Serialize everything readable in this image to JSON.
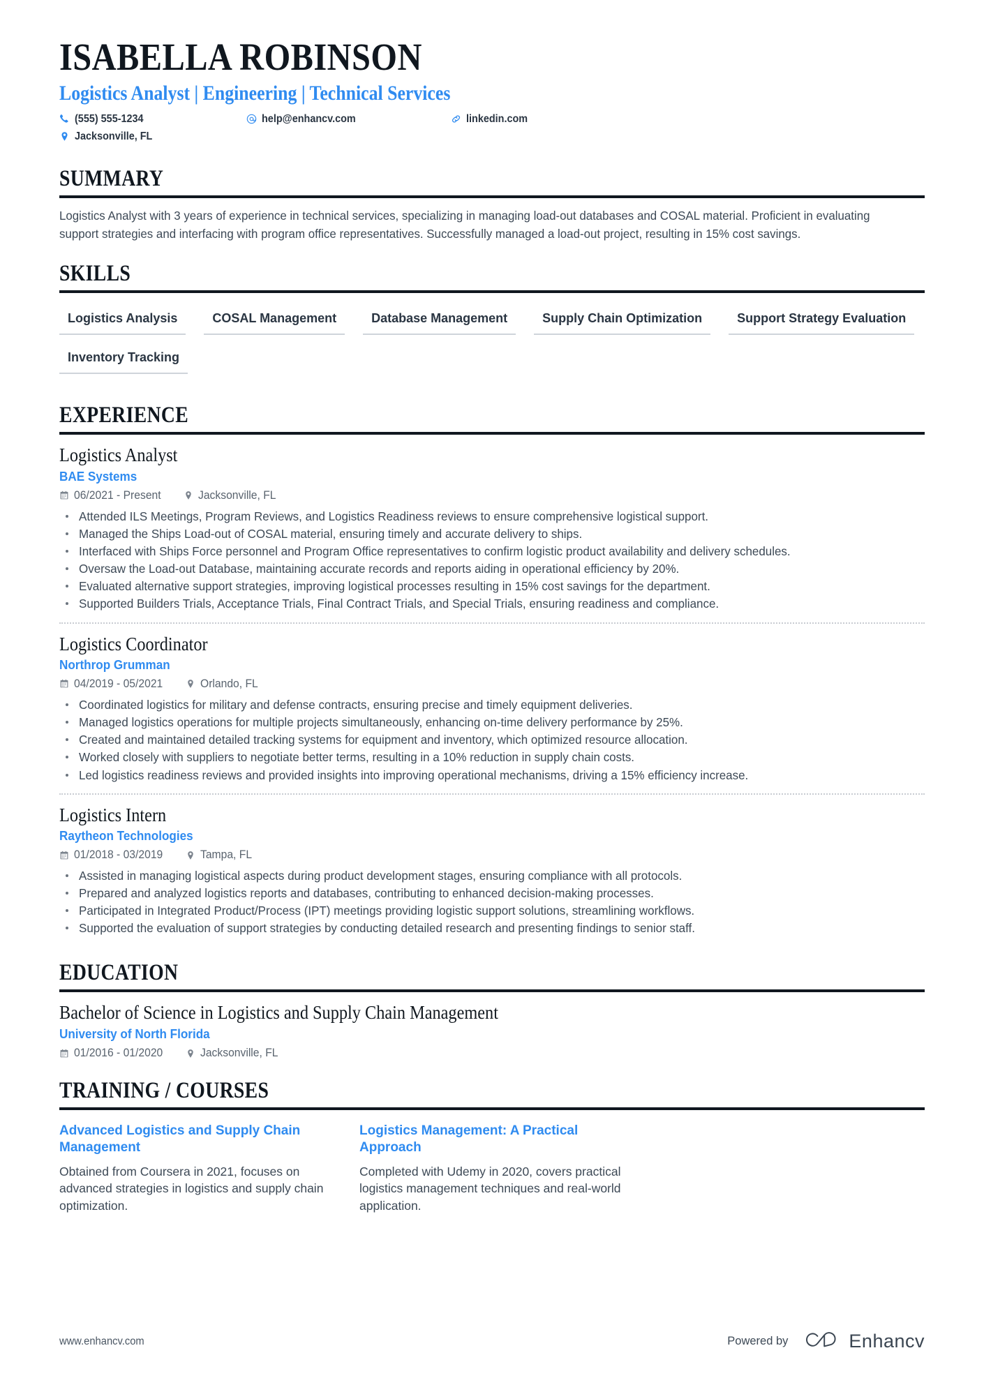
{
  "header": {
    "name": "ISABELLA ROBINSON",
    "headline": "Logistics Analyst | Engineering | Technical Services",
    "contacts": [
      {
        "icon": "phone-icon",
        "value": "(555) 555-1234"
      },
      {
        "icon": "email-icon",
        "value": "help@enhancv.com"
      },
      {
        "icon": "link-icon",
        "value": "linkedin.com"
      },
      {
        "icon": "location-pin-icon",
        "value": "Jacksonville, FL"
      }
    ]
  },
  "sections": {
    "summary": {
      "title": "SUMMARY",
      "text": "Logistics Analyst with 3 years of experience in technical services, specializing in managing load-out databases and COSAL material. Proficient in evaluating support strategies and interfacing with program office representatives. Successfully managed a load-out project, resulting in 15% cost savings."
    },
    "skills": {
      "title": "SKILLS",
      "items": [
        "Logistics Analysis",
        "COSAL Management",
        "Database Management",
        "Supply Chain Optimization",
        "Support Strategy Evaluation",
        "Inventory Tracking"
      ]
    },
    "experience": {
      "title": "EXPERIENCE",
      "jobs": [
        {
          "title": "Logistics Analyst",
          "company": "BAE Systems",
          "dates": "06/2021 - Present",
          "location": "Jacksonville, FL",
          "bullets": [
            "Attended ILS Meetings, Program Reviews, and Logistics Readiness reviews to ensure comprehensive logistical support.",
            "Managed the Ships Load-out of COSAL material, ensuring timely and accurate delivery to ships.",
            "Interfaced with Ships Force personnel and Program Office representatives to confirm logistic product availability and delivery schedules.",
            "Oversaw the Load-out Database, maintaining accurate records and reports aiding in operational efficiency by 20%.",
            "Evaluated alternative support strategies, improving logistical processes resulting in 15% cost savings for the department.",
            "Supported Builders Trials, Acceptance Trials, Final Contract Trials, and Special Trials, ensuring readiness and compliance."
          ]
        },
        {
          "title": "Logistics Coordinator",
          "company": "Northrop Grumman",
          "dates": "04/2019 - 05/2021",
          "location": "Orlando, FL",
          "bullets": [
            "Coordinated logistics for military and defense contracts, ensuring precise and timely equipment deliveries.",
            "Managed logistics operations for multiple projects simultaneously, enhancing on-time delivery performance by 25%.",
            "Created and maintained detailed tracking systems for equipment and inventory, which optimized resource allocation.",
            "Worked closely with suppliers to negotiate better terms, resulting in a 10% reduction in supply chain costs.",
            "Led logistics readiness reviews and provided insights into improving operational mechanisms, driving a 15% efficiency increase."
          ]
        },
        {
          "title": "Logistics Intern",
          "company": "Raytheon Technologies",
          "dates": "01/2018 - 03/2019",
          "location": "Tampa, FL",
          "bullets": [
            "Assisted in managing logistical aspects during product development stages, ensuring compliance with all protocols.",
            "Prepared and analyzed logistics reports and databases, contributing to enhanced decision-making processes.",
            "Participated in Integrated Product/Process (IPT) meetings providing logistic support solutions, streamlining workflows.",
            "Supported the evaluation of support strategies by conducting detailed research and presenting findings to senior staff."
          ]
        }
      ]
    },
    "education": {
      "title": "EDUCATION",
      "entries": [
        {
          "degree": "Bachelor of Science in Logistics and Supply Chain Management",
          "school": "University of North Florida",
          "dates": "01/2016 - 01/2020",
          "location": "Jacksonville, FL"
        }
      ]
    },
    "training": {
      "title": "TRAINING / COURSES",
      "courses": [
        {
          "title": "Advanced Logistics and Supply Chain Management",
          "description": "Obtained from Coursera in 2021, focuses on advanced strategies in logistics and supply chain optimization."
        },
        {
          "title": "Logistics Management: A Practical Approach",
          "description": "Completed with Udemy in 2020, covers practical logistics management techniques and real-world application."
        }
      ]
    }
  },
  "footer": {
    "url": "www.enhancv.com",
    "powered_by": "Powered by",
    "brand": "Enhancv"
  },
  "colors": {
    "accent_blue": "#2f8bf0",
    "heading_black": "#10171f",
    "body_gray": "#3d4956",
    "meta_gray": "#59636e"
  }
}
